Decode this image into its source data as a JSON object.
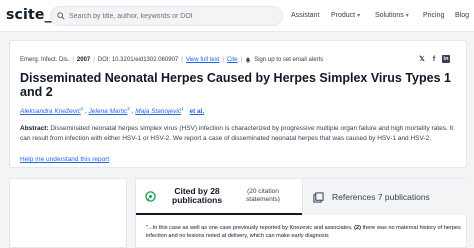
{
  "header": {
    "logo": "scite_",
    "search_placeholder": "Search by title, author, keywords or DOI",
    "nav": {
      "assistant": "Assistant",
      "product": "Product",
      "solutions": "Solutions",
      "pricing": "Pricing",
      "blog": "Blog"
    }
  },
  "paper": {
    "journal": "Emerg. Infect. Dis.",
    "year": "2007",
    "doi": "DOI: 10.3201/eid1302.060907",
    "full_text_link": "View full text",
    "cite_link": "Cite",
    "alerts_label": "Sign up to set email alerts",
    "title": "Disseminated Neonatal Herpes Caused by Herpes Simplex Virus Types 1 and 2",
    "authors": [
      {
        "name": "Aleksandra Knežević",
        "sup": "1"
      },
      {
        "name": "Jelena Martic",
        "sup": "2"
      },
      {
        "name": "Maja Stanojević",
        "sup": "1"
      }
    ],
    "et_al": "et al.",
    "abstract_label": "Abstract:",
    "abstract_text": "Disseminated neonatal herpes simplex virus (HSV) infection is characterized by progressive multiple organ failure and high mortality rates. It can result from infection with either HSV-1 or HSV-2. We report a case of disseminated neonatal herpes that was caused by HSV-1 and HSV-2.",
    "help_link": "Help me understand this report"
  },
  "citations": {
    "cited_by": "Cited by 28 publications",
    "statements": "(20 citation statements)",
    "references": "References 7 publications",
    "snippet_start": "\"...In this case as well as one case previously reported by Knezevic and associates,",
    "snippet_ref": "(2)",
    "snippet_end": "there was no maternal history of herpes infection and no lesions noted at delivery, which can make early diagnosis"
  },
  "colors": {
    "link": "#2563eb",
    "text": "#1f2937",
    "accent_green": "#16a34a",
    "background": "#f3f4f6"
  }
}
